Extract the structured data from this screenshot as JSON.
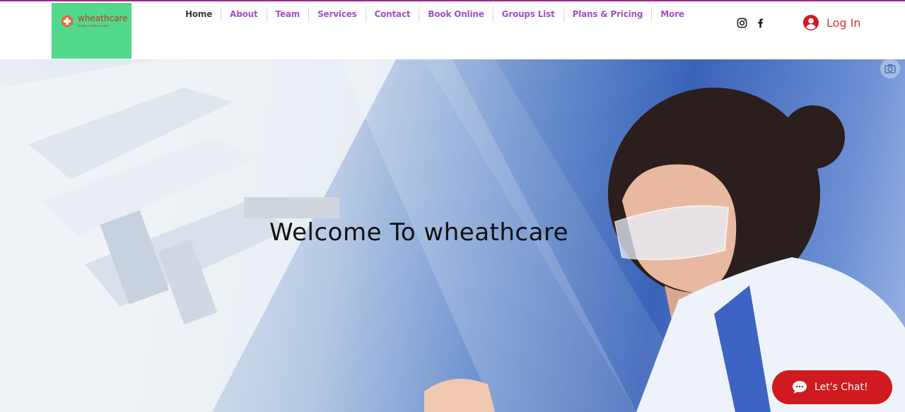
{
  "logo": {
    "name": "wheathcare",
    "tagline": "Bubbly health wisdom",
    "icon": "health-cross-icon"
  },
  "nav": {
    "items": [
      {
        "label": "Home"
      },
      {
        "label": "About"
      },
      {
        "label": "Team"
      },
      {
        "label": "Services"
      },
      {
        "label": "Contact"
      },
      {
        "label": "Book Online"
      },
      {
        "label": "Groups List"
      },
      {
        "label": "Plans & Pricing"
      },
      {
        "label": "More"
      }
    ]
  },
  "social": {
    "icons": [
      "instagram-icon",
      "facebook-icon"
    ]
  },
  "login": {
    "label": "Log In",
    "icon": "user-avatar-icon"
  },
  "hero": {
    "title": "Welcome To wheathcare",
    "image": "scientist-in-lab-photo"
  },
  "chat": {
    "label": "Let's Chat!",
    "icon": "chat-bubble-icon"
  },
  "colors": {
    "brand_purple": "#a052c8",
    "accent_red": "#d11a1f",
    "logo_bg": "#52d98c",
    "topline": "#a0268f"
  }
}
